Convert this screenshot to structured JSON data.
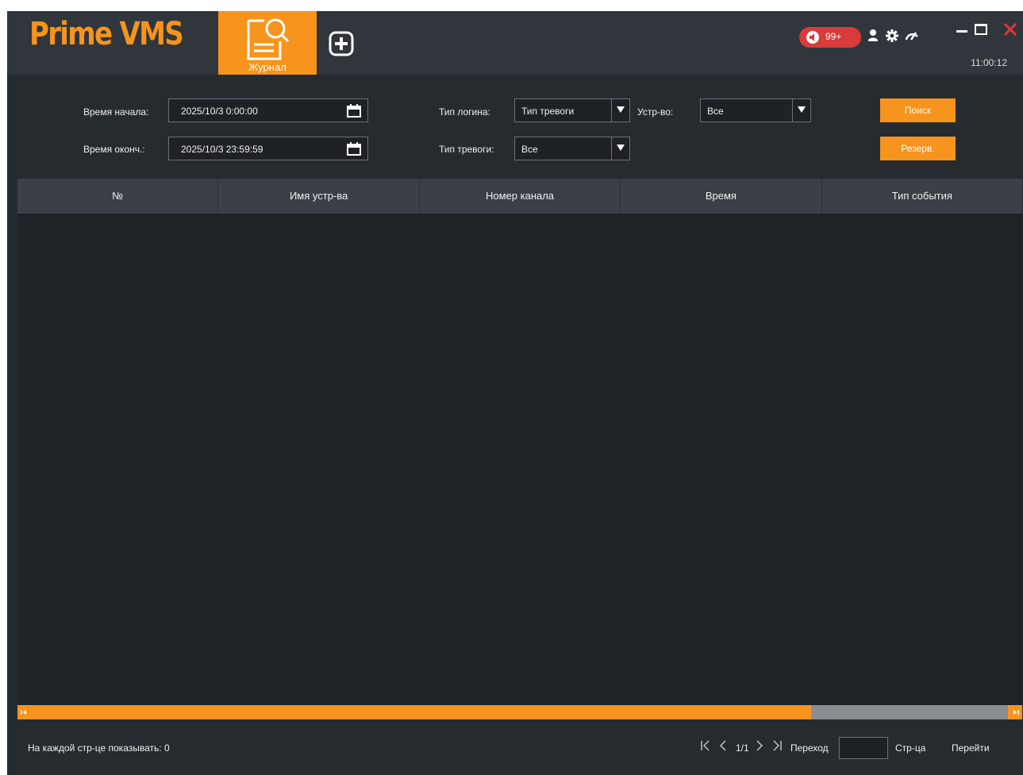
{
  "app": {
    "logo": "Prime VMS",
    "tabs": [
      {
        "label": "Журнал",
        "active": true
      }
    ],
    "alarm_count": "99+",
    "clock": "11:00:12",
    "accent_color": "#f7941d",
    "alert_color": "#d93a3a"
  },
  "filters": {
    "start_time_label": "Время начала:",
    "start_time_value": "2025/10/3 0:00:00",
    "end_time_label": "Время оконч.:",
    "end_time_value": "2025/10/3 23:59:59",
    "log_type_label": "Тип логина:",
    "log_type_value": "Тип тревоги",
    "device_label": "Устр-во:",
    "device_value": "Все",
    "alarm_type_label": "Тип тревоги:",
    "alarm_type_value": "Все",
    "search_button": "Поиск",
    "backup_button": "Резерв."
  },
  "table": {
    "columns": [
      "№",
      "Имя устр-ва",
      "Номер канала",
      "Время",
      "Тип события"
    ],
    "rows": []
  },
  "footer": {
    "per_page_label": "На каждой стр-це показывать:",
    "per_page_value": "0",
    "page_indicator": "1/1",
    "goto_label": "Переход",
    "page_suffix": "Стр-ца",
    "go_button": "Перейти",
    "icons": [
      "first-page-icon",
      "prev-page-icon",
      "next-page-icon",
      "last-page-icon"
    ]
  }
}
